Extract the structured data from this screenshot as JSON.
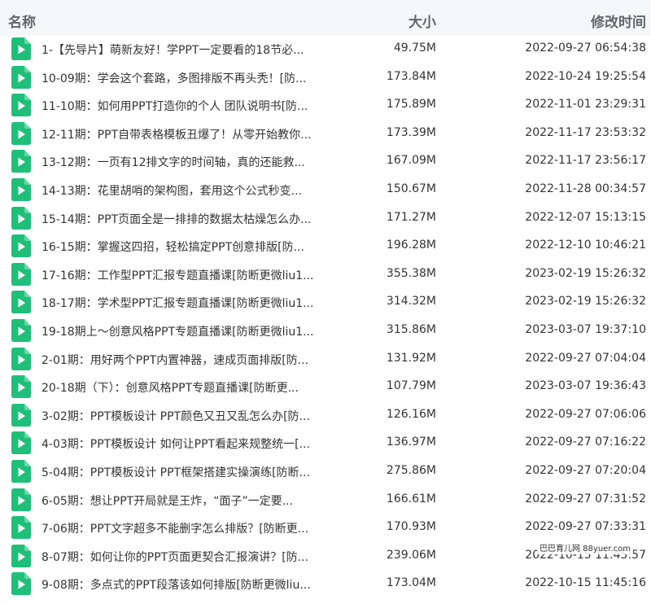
{
  "header": {
    "name": "名称",
    "size": "大小",
    "modified": "修改时间"
  },
  "file_icon": "video-file-icon",
  "colors": {
    "icon_green": "#1fbf7a",
    "header_bg": "#f6f7f9"
  },
  "files": [
    {
      "name": "1-【先导片】萌新友好！学PPT一定要看的18节必...",
      "size": "49.75M",
      "modified": "2022-09-27 06:54:38"
    },
    {
      "name": "10-09期：学会这个套路，多图排版不再头秃！[防...",
      "size": "173.84M",
      "modified": "2022-10-24 19:25:54"
    },
    {
      "name": "11-10期：如何用PPT打造你的个人 团队说明书[防...",
      "size": "175.89M",
      "modified": "2022-11-01 23:29:31"
    },
    {
      "name": "12-11期：PPT自带表格模板丑爆了！从零开始教你...",
      "size": "173.39M",
      "modified": "2022-11-17 23:53:32"
    },
    {
      "name": "13-12期：一页有12排文字的时间轴，真的还能救...",
      "size": "167.09M",
      "modified": "2022-11-17 23:56:17"
    },
    {
      "name": "14-13期：花里胡哨的架构图，套用这个公式秒变...",
      "size": "150.67M",
      "modified": "2022-11-28 00:34:57"
    },
    {
      "name": "15-14期：PPT页面全是一排排的数据太枯燥怎么办...",
      "size": "171.27M",
      "modified": "2022-12-07 15:13:15"
    },
    {
      "name": "16-15期：掌握这四招，轻松搞定PPT创意排版[防...",
      "size": "196.28M",
      "modified": "2022-12-10 10:46:21"
    },
    {
      "name": "17-16期：工作型PPT汇报专题直播课[防断更微liu1...",
      "size": "355.38M",
      "modified": "2023-02-19 15:26:32"
    },
    {
      "name": "18-17期：学术型PPT汇报专题直播课[防断更微liu1...",
      "size": "314.32M",
      "modified": "2023-02-19 15:26:32"
    },
    {
      "name": "19-18期上～创意风格PPT专题直播课[防断更微liu1...",
      "size": "315.86M",
      "modified": "2023-03-07 19:37:10"
    },
    {
      "name": "2-01期：用好两个PPT内置神器，速成页面排版[防...",
      "size": "131.92M",
      "modified": "2022-09-27 07:04:04"
    },
    {
      "name": "20-18期（下）：创意风格PPT专题直播课[防断更...",
      "size": "107.79M",
      "modified": "2023-03-07 19:36:43"
    },
    {
      "name": "3-02期：PPT模板设计 PPT颜色又丑又乱怎么办[防...",
      "size": "126.16M",
      "modified": "2022-09-27 07:06:06"
    },
    {
      "name": "4-03期：PPT模板设计 如何让PPT看起来规整统一[...",
      "size": "136.97M",
      "modified": "2022-09-27 07:16:22"
    },
    {
      "name": "5-04期：PPT模板设计 PPT框架搭建实操演练[防断...",
      "size": "275.86M",
      "modified": "2022-09-27 07:20:04"
    },
    {
      "name": "6-05期：想让PPT开局就是王炸，“面子”一定要...",
      "size": "166.61M",
      "modified": "2022-09-27 07:31:52"
    },
    {
      "name": "7-06期：PPT文字超多不能删字怎么排版？[防断更...",
      "size": "170.93M",
      "modified": "2022-09-27 07:33:31"
    },
    {
      "name": "8-07期：如何让你的PPT页面更契合汇报演讲？[防...",
      "size": "239.06M",
      "modified": "2022-10-15 11:45:57"
    },
    {
      "name": "9-08期：多点式的PPT段落该如何排版[防断更微liu...",
      "size": "173.04M",
      "modified": "2022-10-15 11:45:16"
    }
  ],
  "watermark": "巴巴育儿网 88yuer.com"
}
